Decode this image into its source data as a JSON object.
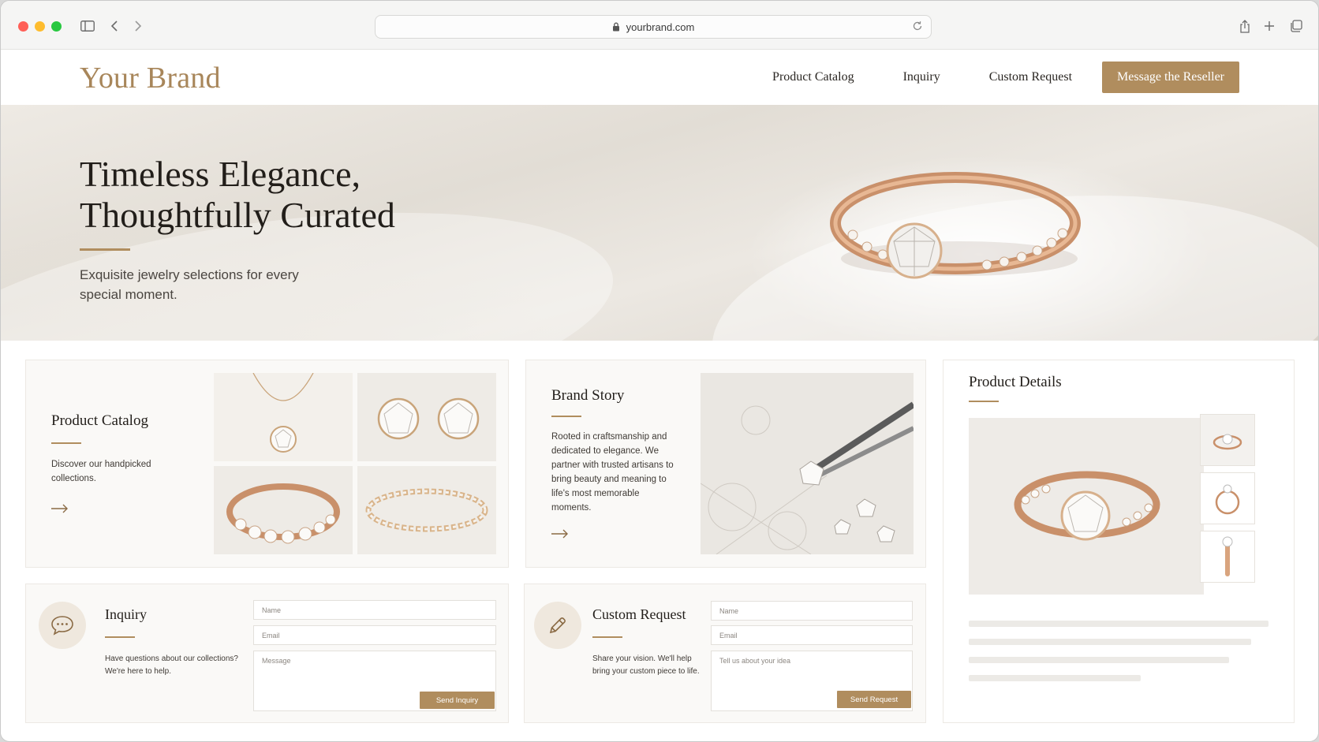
{
  "browser": {
    "url": "yourbrand.com"
  },
  "header": {
    "brand": "Your Brand",
    "nav": [
      "Product Catalog",
      "Inquiry",
      "Custom Request"
    ],
    "cta": "Message the Reseller"
  },
  "hero": {
    "title_line1": "Timeless Elegance,",
    "title_line2": "Thoughtfully Curated",
    "subtitle": "Exquisite jewelry selections for every special moment."
  },
  "catalog": {
    "title": "Product Catalog",
    "text": "Discover our handpicked collections."
  },
  "story": {
    "title": "Brand Story",
    "text": "Rooted in craftsmanship and dedicated to elegance. We partner with trusted artisans to bring beauty and meaning to life's most memorable moments."
  },
  "details": {
    "title": "Product Details"
  },
  "inquiry": {
    "title": "Inquiry",
    "text": "Have questions about our collections? We're here to help.",
    "name_placeholder": "Name",
    "email_placeholder": "Email",
    "message_placeholder": "Message",
    "button": "Send Inquiry"
  },
  "custom": {
    "title": "Custom Request",
    "text": "Share your vision. We'll help bring your custom piece to life.",
    "name_placeholder": "Name",
    "email_placeholder": "Email",
    "message_placeholder": "Tell us about your idea",
    "button": "Send Request"
  },
  "colors": {
    "accent": "#b08d5e",
    "brand": "#a8865a",
    "card_bg": "#faf9f7"
  }
}
